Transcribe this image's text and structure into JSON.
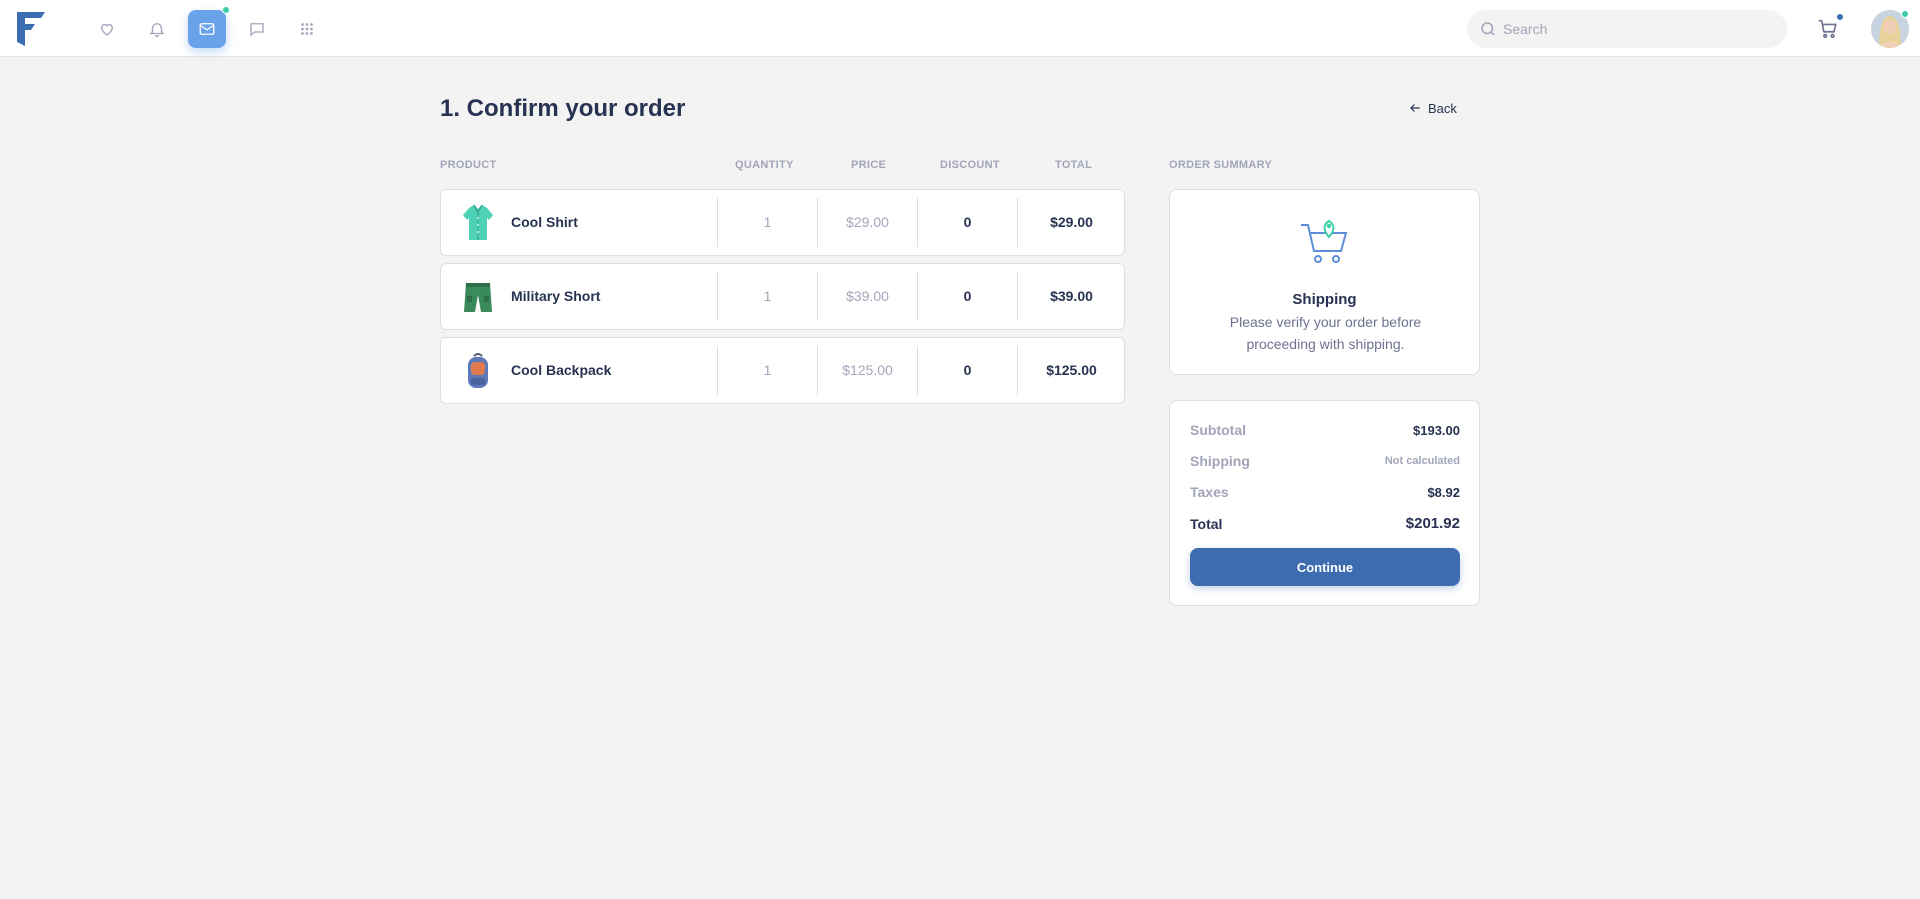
{
  "nav": {
    "icons": [
      "heart-icon",
      "bell-icon",
      "mail-icon",
      "chat-icon",
      "grid-icon"
    ],
    "active": "mail-icon",
    "search_placeholder": "Search",
    "colors": {
      "accent": "#6aa2e9",
      "brand": "#3d6cb1",
      "notify": "#3ccda8"
    }
  },
  "page": {
    "title": "1. Confirm your order",
    "back_label": "Back"
  },
  "columns": {
    "product": "PRODUCT",
    "quantity": "QUANTITY",
    "price": "PRICE",
    "discount": "DISCOUNT",
    "total": "TOTAL",
    "summary": "ORDER SUMMARY"
  },
  "items": [
    {
      "name": "Cool Shirt",
      "quantity": "1",
      "price": "$29.00",
      "discount": "0",
      "total": "$29.00",
      "icon": "shirt-icon"
    },
    {
      "name": "Military Short",
      "quantity": "1",
      "price": "$39.00",
      "discount": "0",
      "total": "$39.00",
      "icon": "shorts-icon"
    },
    {
      "name": "Cool Backpack",
      "quantity": "1",
      "price": "$125.00",
      "discount": "0",
      "total": "$125.00",
      "icon": "backpack-icon"
    }
  ],
  "summary": {
    "title": "Shipping",
    "text": "Please verify your order before proceeding with shipping."
  },
  "totals": {
    "subtotal_label": "Subtotal",
    "subtotal": "$193.00",
    "shipping_label": "Shipping",
    "shipping": "Not calculated",
    "taxes_label": "Taxes",
    "taxes": "$8.92",
    "total_label": "Total",
    "total": "$201.92",
    "continue_label": "Continue"
  }
}
